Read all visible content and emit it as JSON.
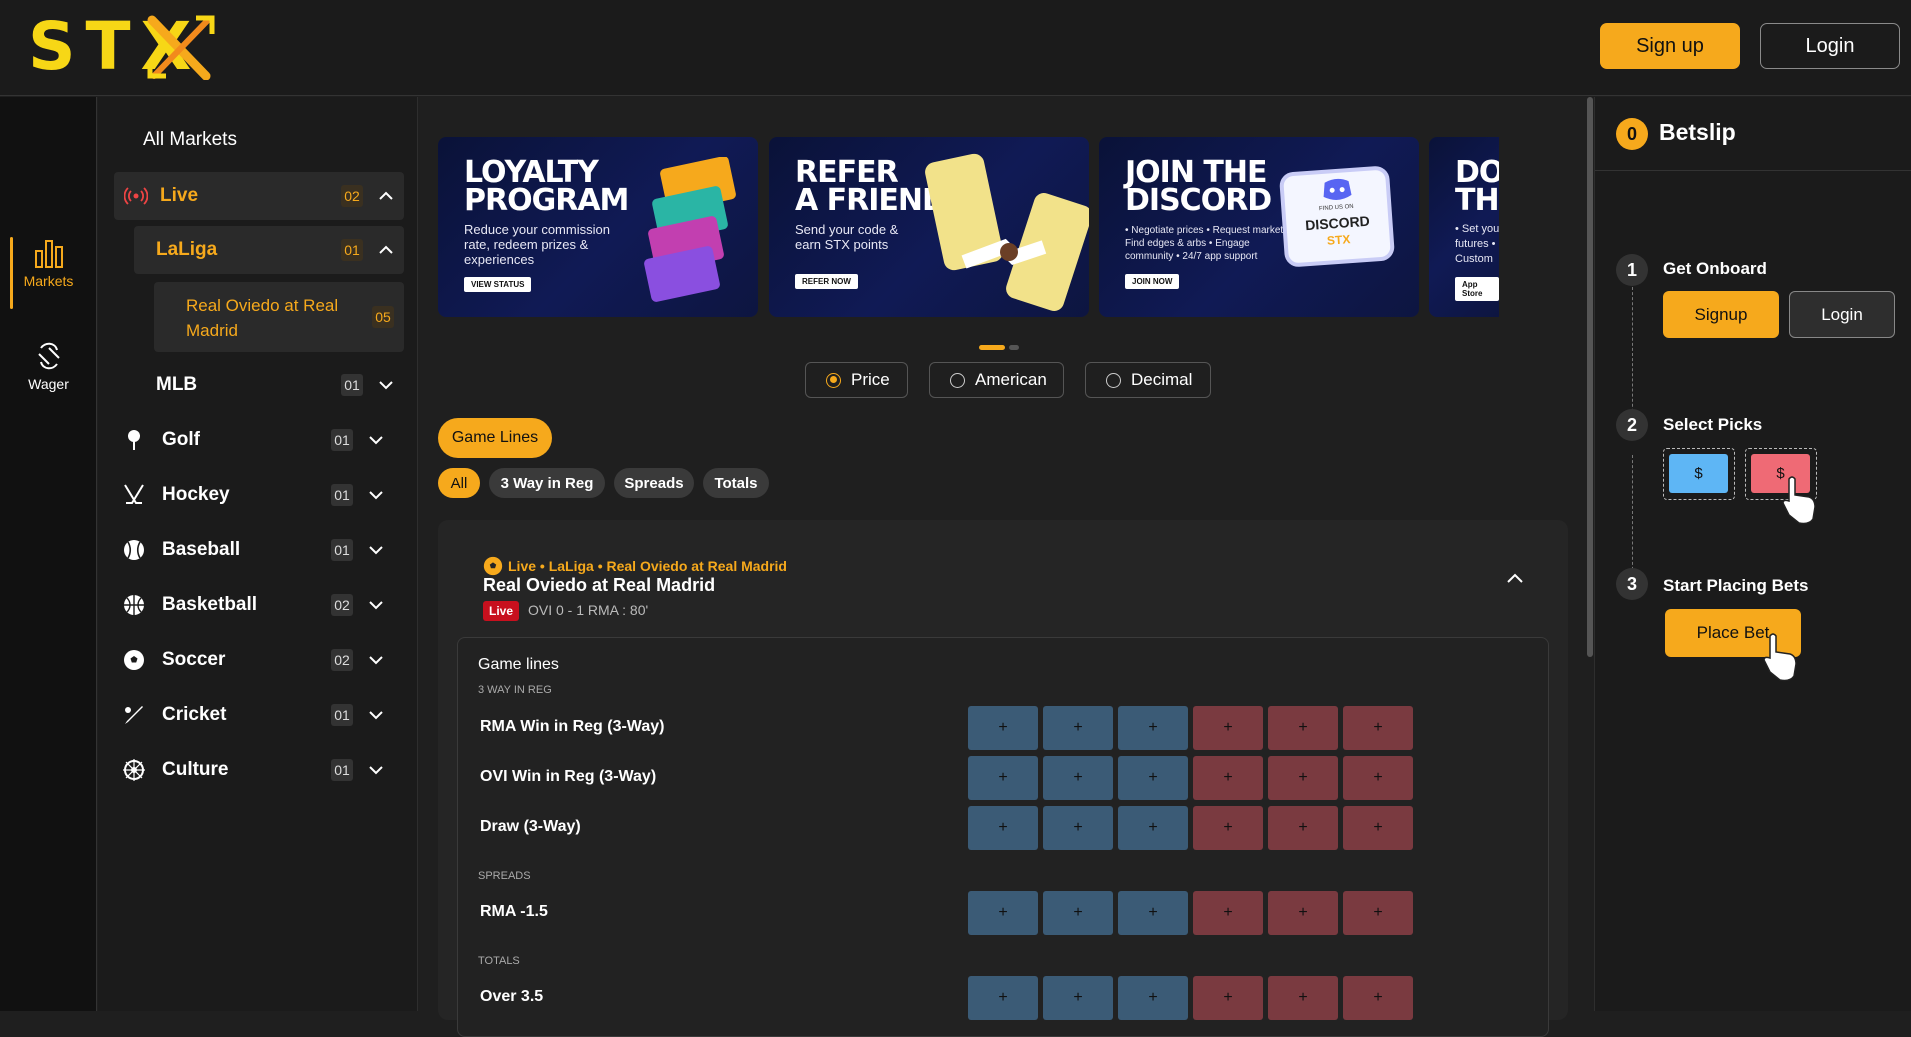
{
  "header": {
    "logo_text": "STX",
    "signup_label": "Sign up",
    "login_label": "Login",
    "brand_color": "#f6a91c"
  },
  "rail": {
    "items": [
      {
        "label": "Markets",
        "icon": "bar-chart-icon",
        "active": true
      },
      {
        "label": "Wager",
        "icon": "wager-icon",
        "active": false
      }
    ]
  },
  "sidebar": {
    "title": "All Markets",
    "live": {
      "label": "Live",
      "count": "02",
      "icon": "live-broadcast-icon"
    },
    "laliga": {
      "label": "LaLiga",
      "count": "01"
    },
    "event": {
      "label": "Real Oviedo at Real Madrid",
      "count": "05"
    },
    "mlb": {
      "label": "MLB",
      "count": "01"
    },
    "sports": [
      {
        "label": "Golf",
        "count": "01",
        "icon": "golf-icon"
      },
      {
        "label": "Hockey",
        "count": "01",
        "icon": "hockey-icon"
      },
      {
        "label": "Baseball",
        "count": "01",
        "icon": "baseball-icon"
      },
      {
        "label": "Basketball",
        "count": "02",
        "icon": "basketball-icon"
      },
      {
        "label": "Soccer",
        "count": "02",
        "icon": "soccer-icon"
      },
      {
        "label": "Cricket",
        "count": "01",
        "icon": "cricket-icon"
      },
      {
        "label": "Culture",
        "count": "01",
        "icon": "culture-icon"
      }
    ]
  },
  "banners": [
    {
      "title1": "LOYALTY",
      "title2": "PROGRAM",
      "text": "Reduce your commission rate, redeem prizes & experiences",
      "cta": "VIEW STATUS"
    },
    {
      "title1": "REFER",
      "title2": "A FRIEND",
      "text": "Send your code & earn STX points",
      "cta": "REFER NOW"
    },
    {
      "title1": "JOIN THE",
      "title2": "DISCORD",
      "text": "• Negotiate prices • Request markets • Find edges & arbs • Engage community • 24/7 app support",
      "cta": "JOIN NOW",
      "badge": "DISCORD",
      "badge_small": "FIND US ON",
      "badge_brand": "STX"
    },
    {
      "title1": "DO",
      "title2": "TH",
      "text": "• Set you futures • Custom",
      "cta": "App Store"
    }
  ],
  "odds_format": {
    "options": [
      "Price",
      "American",
      "Decimal"
    ],
    "selected": "Price"
  },
  "game_lines_label": "Game Lines",
  "filters": [
    "All",
    "3 Way in Reg",
    "Spreads",
    "Totals"
  ],
  "event": {
    "crumb": "Live • LaLiga • Real Oviedo at Real Madrid",
    "title": "Real Oviedo at Real Madrid",
    "live_badge": "Live",
    "score": "OVI 0 - 1 RMA : 80'"
  },
  "lines": {
    "title": "Game lines",
    "sections": [
      {
        "label": "3 WAY IN REG",
        "markets": [
          "RMA Win in Reg (3-Way)",
          "OVI Win in Reg (3-Way)",
          "Draw (3-Way)"
        ]
      },
      {
        "label": "SPREADS",
        "markets": [
          "RMA -1.5"
        ]
      },
      {
        "label": "TOTALS",
        "markets": [
          "Over 3.5"
        ]
      }
    ],
    "cell_symbol": "+",
    "buy_color": "#3b5b76",
    "sell_color": "#7a3a40"
  },
  "betslip": {
    "count": "0",
    "title": "Betslip",
    "steps": [
      {
        "num": "1",
        "label": "Get Onboard"
      },
      {
        "num": "2",
        "label": "Select Picks"
      },
      {
        "num": "3",
        "label": "Start Placing Bets"
      }
    ],
    "signup_label": "Signup",
    "login_label": "Login",
    "pick_symbol": "$",
    "place_bet_label": "Place Bet"
  }
}
